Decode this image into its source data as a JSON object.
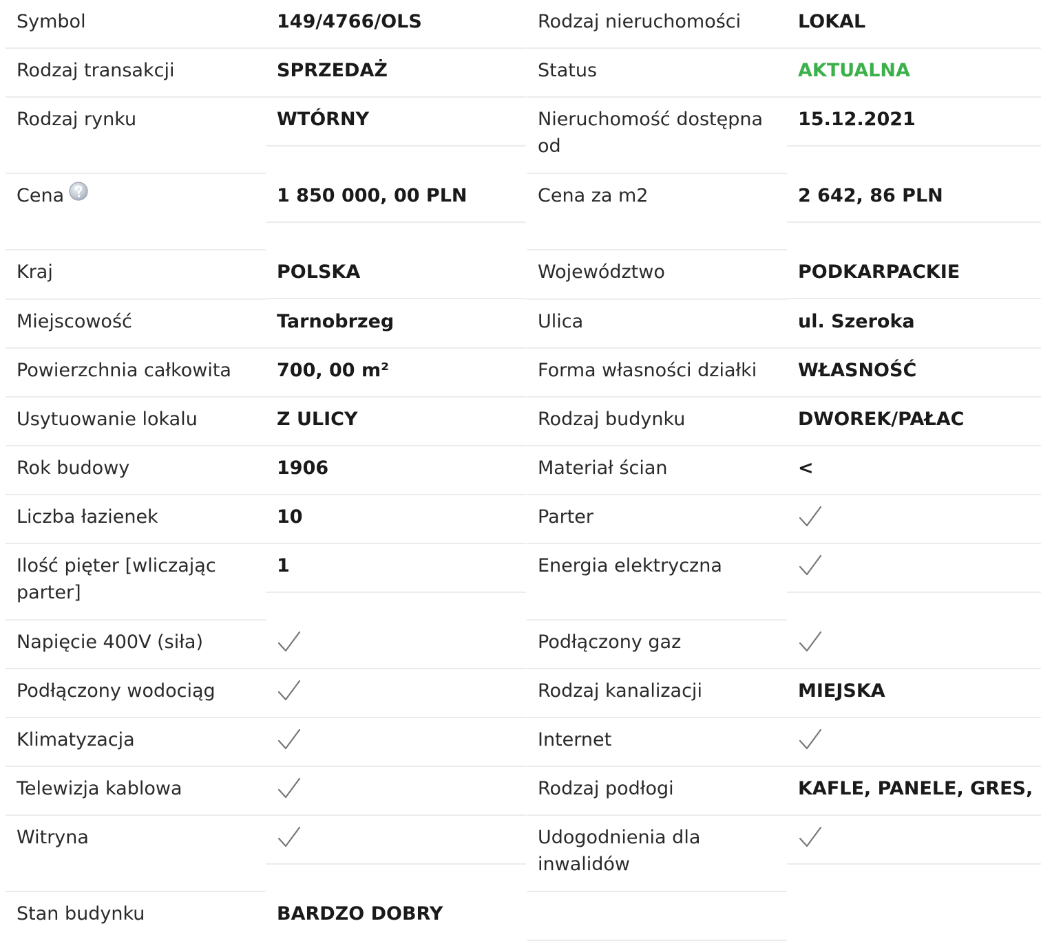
{
  "left": [
    {
      "label": "Symbol",
      "value": "149/4766/OLS",
      "kind": "text"
    },
    {
      "label": "Rodzaj transakcji",
      "value": "SPRZEDAŻ",
      "kind": "text"
    },
    {
      "label": "Rodzaj rynku",
      "value": "WTÓRNY",
      "kind": "text"
    },
    {
      "label": "Cena",
      "value": "1 850 000, 00 PLN",
      "kind": "text",
      "help_icon": "question-icon"
    },
    {
      "label": "Kraj",
      "value": "POLSKA",
      "kind": "text"
    },
    {
      "label": "Miejscowość",
      "value": "Tarnobrzeg",
      "kind": "text"
    },
    {
      "label": "Powierzchnia całkowita",
      "value": "700, 00 m²",
      "kind": "text"
    },
    {
      "label": "Usytuowanie lokalu",
      "value": "Z ULICY",
      "kind": "text"
    },
    {
      "label": "Rok budowy",
      "value": "1906",
      "kind": "text"
    },
    {
      "label": "Liczba łazienek",
      "value": "10",
      "kind": "text"
    },
    {
      "label": "Ilość pięter [wliczając parter]",
      "value": "1",
      "kind": "text"
    },
    {
      "label": "Napięcie 400V (siła)",
      "value": "",
      "kind": "check"
    },
    {
      "label": "Podłączony wodociąg",
      "value": "",
      "kind": "check"
    },
    {
      "label": "Klimatyzacja",
      "value": "",
      "kind": "check"
    },
    {
      "label": "Telewizja kablowa",
      "value": "",
      "kind": "check"
    },
    {
      "label": "Witryna",
      "value": "",
      "kind": "check"
    },
    {
      "label": "Stan budynku",
      "value": "BARDZO DOBRY",
      "kind": "text"
    }
  ],
  "right": [
    {
      "label": "Rodzaj nieruchomości",
      "value": "LOKAL",
      "kind": "text"
    },
    {
      "label": "Status",
      "value": "AKTUALNA",
      "kind": "text",
      "color": "#3cb04a"
    },
    {
      "label": "Nieruchomość dostępna od",
      "value": "15.12.2021",
      "kind": "text"
    },
    {
      "label": "Cena za m2",
      "value": "2 642, 86 PLN",
      "kind": "text"
    },
    {
      "label": "Województwo",
      "value": "PODKARPACKIE",
      "kind": "text"
    },
    {
      "label": "Ulica",
      "value": "ul. Szeroka",
      "kind": "text"
    },
    {
      "label": "Forma własności działki",
      "value": "WŁASNOŚĆ",
      "kind": "text"
    },
    {
      "label": "Rodzaj budynku",
      "value": "DWOREK/PAŁAC",
      "kind": "text"
    },
    {
      "label": "Materiał ścian",
      "value": "<",
      "kind": "text"
    },
    {
      "label": "Parter",
      "value": "",
      "kind": "check"
    },
    {
      "label": "Energia elektryczna",
      "value": "",
      "kind": "check"
    },
    {
      "label": "Podłączony gaz",
      "value": "",
      "kind": "check"
    },
    {
      "label": "Rodzaj kanalizacji",
      "value": "MIEJSKA",
      "kind": "text"
    },
    {
      "label": "Internet",
      "value": "",
      "kind": "check"
    },
    {
      "label": "Rodzaj podłogi",
      "value": "KAFLE, PANELE, GRES,",
      "kind": "text"
    },
    {
      "label": "Udogodnienia dla inwalidów",
      "value": "",
      "kind": "check"
    },
    {
      "label": "",
      "value": "",
      "kind": "empty"
    }
  ],
  "colors": {
    "status_green": "#3cb04a",
    "check_gray": "#777777",
    "border": "#ececec"
  }
}
